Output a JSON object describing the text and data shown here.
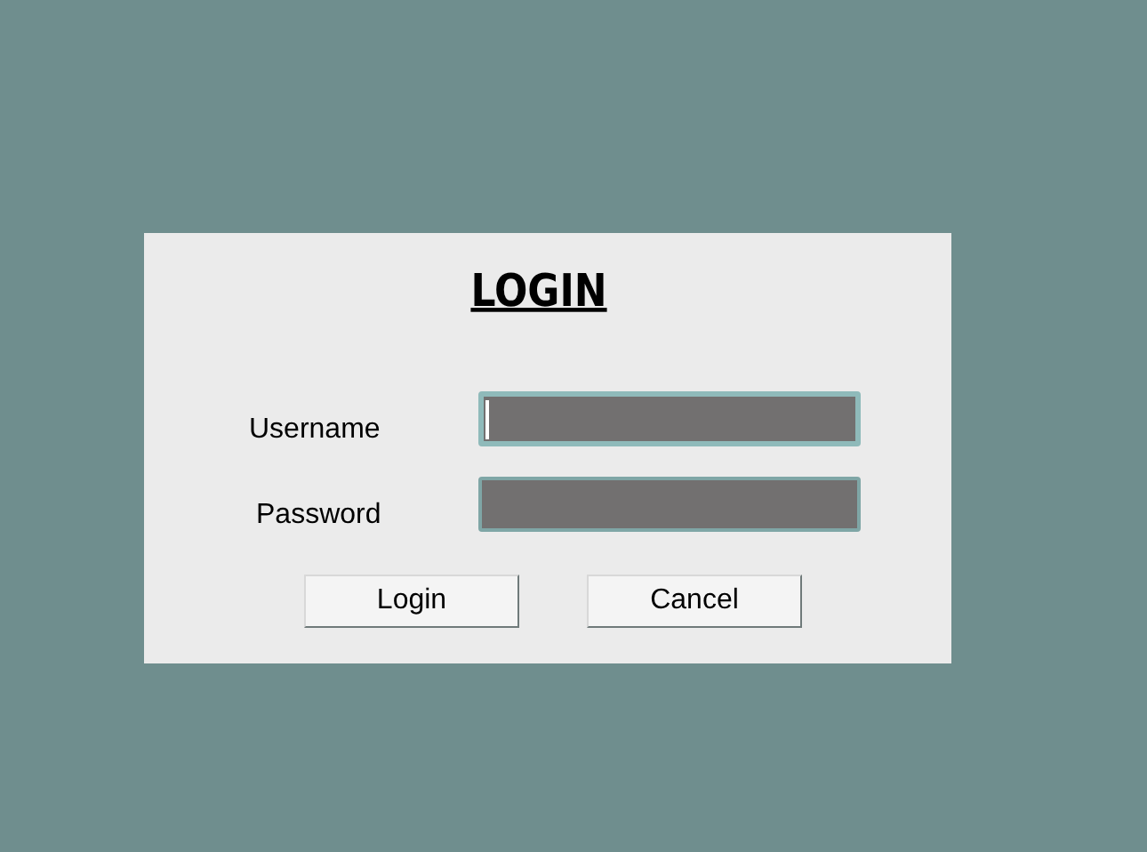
{
  "title": "LOGIN",
  "fields": [
    {
      "label": "Username",
      "focused": true
    },
    {
      "label": "Password",
      "focused": false
    }
  ],
  "buttons": [
    "Login",
    "Cancel"
  ]
}
